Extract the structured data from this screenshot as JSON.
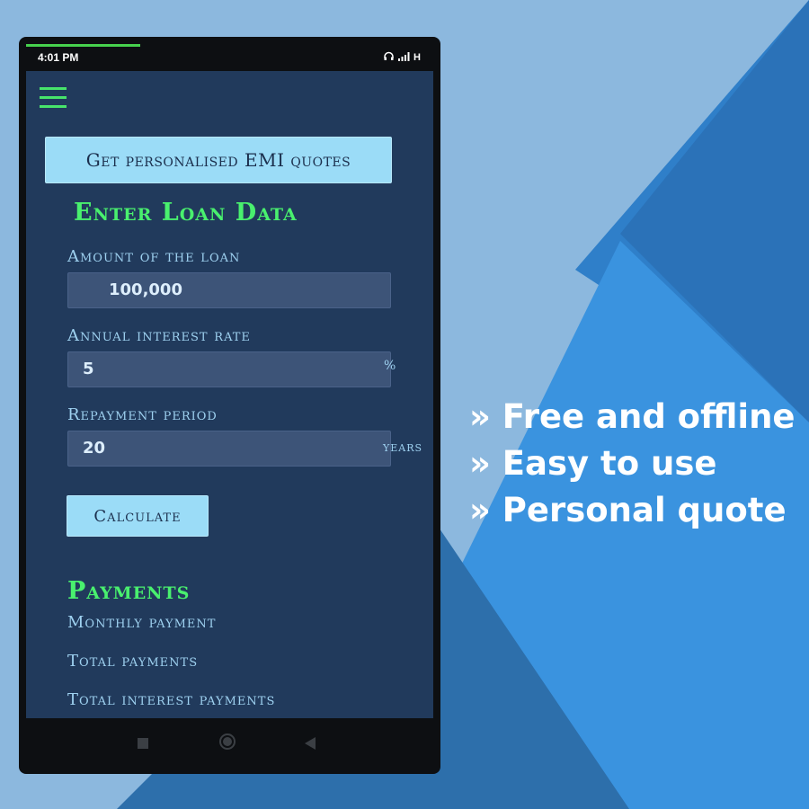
{
  "colors": {
    "background_light": "#8cb8de",
    "background_mid": "#3a8ddb",
    "background_dark": "#2a6fb0",
    "screen_bg": "#213a5c",
    "accent_green": "#49f06e",
    "button_bg": "#9bdcf7",
    "label_color": "#9ed1f0"
  },
  "status_bar": {
    "time": "4:01 PM",
    "network_label": "H",
    "icons": [
      "headphones-icon",
      "signal-icon"
    ]
  },
  "menu": {
    "icon": "hamburger-menu-icon"
  },
  "quote_button": {
    "label": "Get personalised EMI quotes"
  },
  "form": {
    "title": "Enter Loan Data",
    "amount": {
      "label": "Amount of the loan",
      "value": "100,000"
    },
    "interest": {
      "label": "Annual interest rate",
      "value": "5",
      "unit": "%"
    },
    "period": {
      "label": "Repayment period",
      "value": "20",
      "unit": "years"
    },
    "calculate_label": "Calculate"
  },
  "payments": {
    "title": "Payments",
    "monthly_label": "Monthly payment",
    "total_label": "Total payments",
    "interest_label": "Total interest payments"
  },
  "nav_bar": {
    "icons": [
      "recents-icon",
      "home-icon",
      "back-icon"
    ]
  },
  "features": [
    "» Free and offline",
    "» Easy to use",
    "» Personal quote"
  ]
}
